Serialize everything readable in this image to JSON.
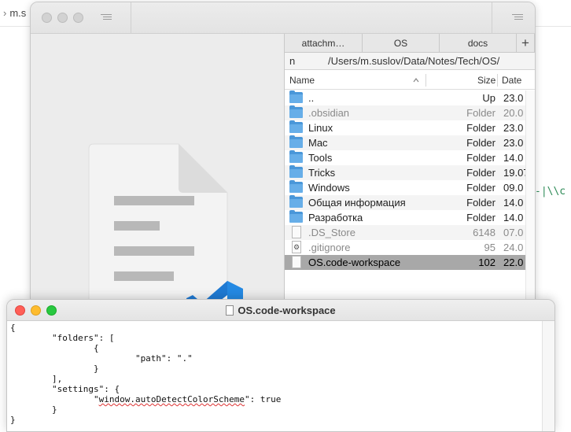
{
  "background_editor": {
    "title_fragment": "m.s",
    "code_fragment": "-|\\\\c"
  },
  "file_manager": {
    "tabs": [
      "attachm…",
      "OS",
      "docs"
    ],
    "add_tab_label": "+",
    "path_prefix": "n",
    "path": "/Users/m.suslov/Data/Notes/Tech/OS/",
    "columns": {
      "name": "Name",
      "size": "Size",
      "date": "Date"
    },
    "rows": [
      {
        "name": "..",
        "size": "Up",
        "date": "23.0",
        "type": "folder"
      },
      {
        "name": ".obsidian",
        "size": "Folder",
        "date": "20.0",
        "type": "folder",
        "dim": true
      },
      {
        "name": "Linux",
        "size": "Folder",
        "date": "23.0",
        "type": "folder"
      },
      {
        "name": "Mac",
        "size": "Folder",
        "date": "23.0",
        "type": "folder"
      },
      {
        "name": "Tools",
        "size": "Folder",
        "date": "14.0",
        "type": "folder"
      },
      {
        "name": "Tricks",
        "size": "Folder",
        "date": "19.07",
        "type": "folder"
      },
      {
        "name": "Windows",
        "size": "Folder",
        "date": "09.0",
        "type": "folder"
      },
      {
        "name": "Общая информация",
        "size": "Folder",
        "date": "14.0",
        "type": "folder"
      },
      {
        "name": "Разработка",
        "size": "Folder",
        "date": "14.0",
        "type": "folder"
      },
      {
        "name": ".DS_Store",
        "size": "6148",
        "date": "07.0",
        "type": "file",
        "dim": true
      },
      {
        "name": ".gitignore",
        "size": "95",
        "date": "24.0",
        "type": "config",
        "dim": true
      },
      {
        "name": "OS.code-workspace",
        "size": "102",
        "date": "22.0",
        "type": "file",
        "selected": true
      }
    ],
    "colors": {
      "selection": "#a8a8a8",
      "folder": "#4a97d9"
    }
  },
  "text_editor": {
    "title": "OS.code-workspace",
    "lines": [
      "{",
      "        \"folders\": [",
      "                {",
      "                        \"path\": \".\"",
      "                }",
      "        ],",
      "        \"settings\": {",
      "                \"window.autoDetectColorScheme\": true",
      "        }",
      "}"
    ],
    "traffic_colors": {
      "close": "#ff5f57",
      "minimize": "#febc2e",
      "zoom": "#28c840"
    }
  }
}
